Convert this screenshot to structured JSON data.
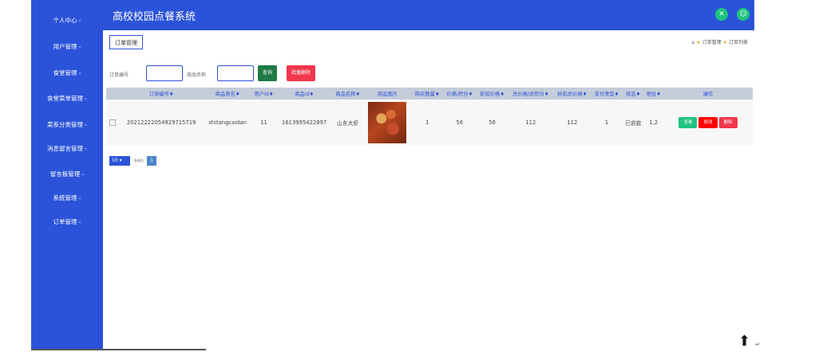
{
  "app": {
    "title": "高校校园点餐系统"
  },
  "top_icons": {
    "close_glyph": "✕",
    "user_glyph": "☺"
  },
  "sidebar": {
    "items": [
      {
        "label": "个人中心"
      },
      {
        "label": "用户管理"
      },
      {
        "label": "食堂管理"
      },
      {
        "label": "食堂菜单管理"
      },
      {
        "label": "菜系分类管理"
      },
      {
        "label": "消息留言管理"
      },
      {
        "label": "留言板管理"
      },
      {
        "label": "系统管理"
      },
      {
        "label": "订单管理"
      }
    ]
  },
  "tab": {
    "label": "订单管理"
  },
  "breadcrumb": {
    "level1": "订单管理",
    "level2": "订单列表"
  },
  "search": {
    "order_no_label": "订单编号",
    "order_no_value": "",
    "product_name_label": "商品名称",
    "product_name_value": "",
    "query_label": "查询",
    "batch_delete_label": "批量删除"
  },
  "table": {
    "headers": [
      "",
      "订单编号♦",
      "商品表名♦",
      "用户id♦",
      "商品id♦",
      "商品名称♦",
      "商品图片",
      "购买数量♦",
      "价格/积分♦",
      "折扣价格♦",
      "总价格/总积分♦",
      "折扣总价格♦",
      "支付类型♦",
      "状态♦",
      "地址♦",
      "操作"
    ],
    "rows": [
      {
        "order_no": "20212222054929715719",
        "table_name": "shitangcaidan",
        "user_id": "11",
        "product_id": "1613995422897",
        "product_name": "山东大虾",
        "quantity": "1",
        "price": "56",
        "discount_price": "56",
        "total_price": "112",
        "discount_total": "112",
        "pay_type": "1",
        "status": "已退款",
        "address": "1,2"
      }
    ],
    "actions": {
      "view": "查看",
      "edit": "修改",
      "delete": "删除"
    }
  },
  "pagination": {
    "page_size": "10",
    "page_size_text": "条每页",
    "current_page": "1"
  },
  "colors": {
    "primary": "#2b53d9",
    "success": "#1ec47f",
    "danger": "#f2364c",
    "query_button": "#1f7a45",
    "edit_button": "#ff0000"
  }
}
